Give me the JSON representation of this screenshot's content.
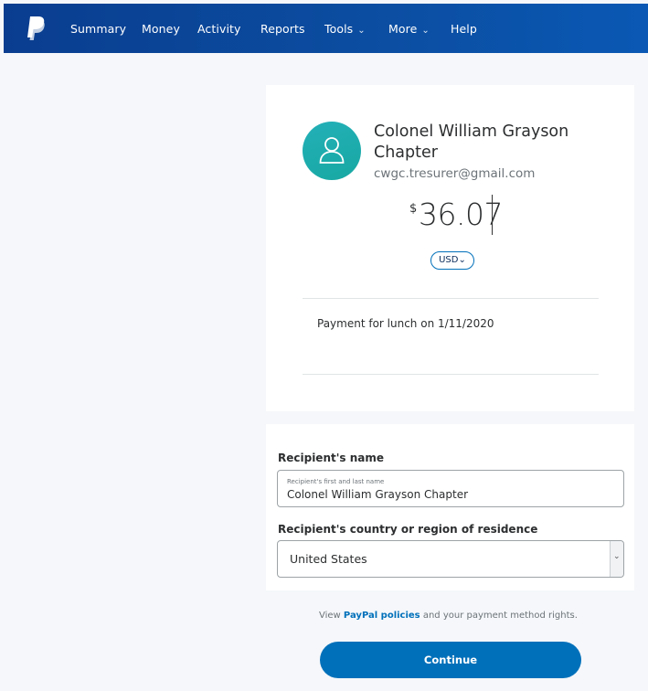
{
  "nav": {
    "items": [
      {
        "label": "Summary"
      },
      {
        "label": "Money"
      },
      {
        "label": "Activity"
      },
      {
        "label": "Reports"
      },
      {
        "label": "Tools"
      },
      {
        "label": "More"
      },
      {
        "label": "Help"
      }
    ],
    "chevron": "⌄"
  },
  "recipient": {
    "name": "Colonel William Grayson Chapter",
    "email": "cwgc.tresurer@gmail.com"
  },
  "amount": {
    "symbol": "$",
    "value": "36.07",
    "currency": "USD"
  },
  "note": "Payment for lunch on 1/11/2020",
  "form": {
    "name_label": "Recipient's name",
    "name_placeholder": "Recipient's first and last name",
    "name_value": "Colonel William Grayson Chapter",
    "country_label": "Recipient's country or region of residence",
    "country_value": "United States"
  },
  "footer": {
    "policies_prefix": "View",
    "policies_link": "PayPal policies",
    "policies_suffix": "and your payment method rights."
  },
  "continue_label": "Continue",
  "colors": {
    "brand_blue": "#0070ba",
    "nav_bg": "#0b4ea2",
    "avatar_teal": "#1fadb3"
  },
  "icons": {
    "logo": "paypal-logo",
    "avatar": "user-icon",
    "dropdown": "chevron-down-icon"
  }
}
